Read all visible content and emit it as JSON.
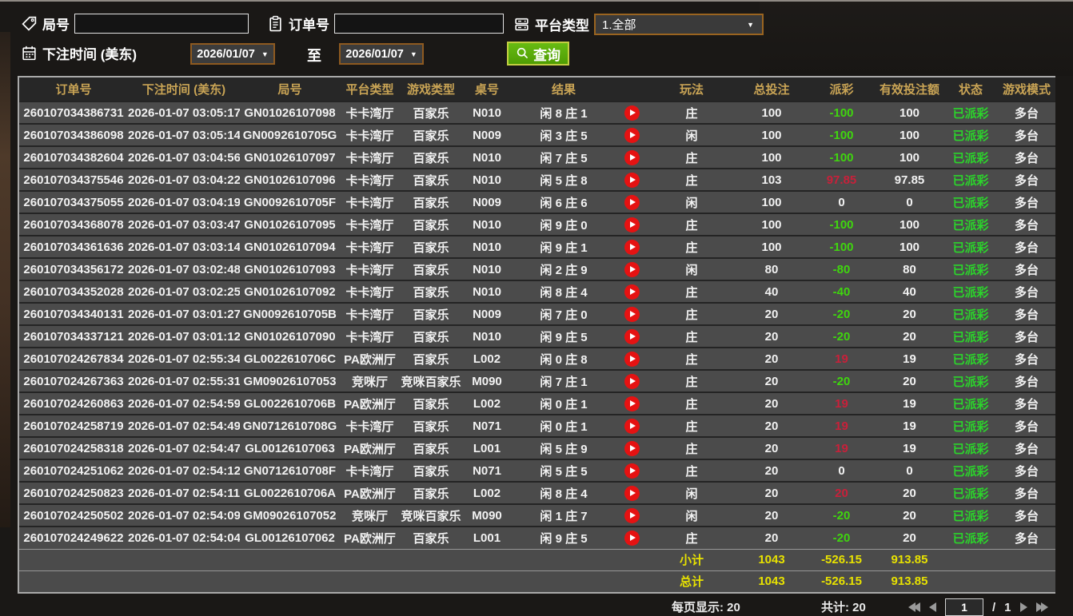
{
  "filters": {
    "game_no": {
      "label": "局号",
      "value": ""
    },
    "order_no": {
      "label": "订单号",
      "value": ""
    },
    "platform_type": {
      "label": "平台类型",
      "value": "1.全部"
    },
    "bet_time": {
      "label": "下注时间 (美东)"
    },
    "date_from": "2026/01/07",
    "to_label": "至",
    "date_to": "2026/01/07",
    "query_label": "查询"
  },
  "table": {
    "headers": [
      "订单号",
      "下注时间 (美东)",
      "局号",
      "平台类型",
      "游戏类型",
      "桌号",
      "结果",
      "",
      "玩法",
      "总投注",
      "派彩",
      "有效投注额",
      "状态",
      "游戏模式"
    ],
    "rows": [
      {
        "order_no": "260107034386731",
        "bet_time": "2026-01-07 03:05:17",
        "game_no": "GN01026107098",
        "platform": "卡卡湾厅",
        "game_type": "百家乐",
        "table_no": "N010",
        "result": "闲 8 庄 1",
        "play": "庄",
        "total_bet": "100",
        "payout": "-100",
        "payout_color": "green",
        "valid_bet": "100",
        "status": "已派彩",
        "mode": "多台"
      },
      {
        "order_no": "260107034386098",
        "bet_time": "2026-01-07 03:05:14",
        "game_no": "GN0092610705G",
        "platform": "卡卡湾厅",
        "game_type": "百家乐",
        "table_no": "N009",
        "result": "闲 3 庄 5",
        "play": "闲",
        "total_bet": "100",
        "payout": "-100",
        "payout_color": "green",
        "valid_bet": "100",
        "status": "已派彩",
        "mode": "多台"
      },
      {
        "order_no": "260107034382604",
        "bet_time": "2026-01-07 03:04:56",
        "game_no": "GN01026107097",
        "platform": "卡卡湾厅",
        "game_type": "百家乐",
        "table_no": "N010",
        "result": "闲 7 庄 5",
        "play": "庄",
        "total_bet": "100",
        "payout": "-100",
        "payout_color": "green",
        "valid_bet": "100",
        "status": "已派彩",
        "mode": "多台"
      },
      {
        "order_no": "260107034375546",
        "bet_time": "2026-01-07 03:04:22",
        "game_no": "GN01026107096",
        "platform": "卡卡湾厅",
        "game_type": "百家乐",
        "table_no": "N010",
        "result": "闲 5 庄 8",
        "play": "庄",
        "total_bet": "103",
        "payout": "97.85",
        "payout_color": "red",
        "valid_bet": "97.85",
        "status": "已派彩",
        "mode": "多台"
      },
      {
        "order_no": "260107034375055",
        "bet_time": "2026-01-07 03:04:19",
        "game_no": "GN0092610705F",
        "platform": "卡卡湾厅",
        "game_type": "百家乐",
        "table_no": "N009",
        "result": "闲 6 庄 6",
        "play": "闲",
        "total_bet": "100",
        "payout": "0",
        "payout_color": "white",
        "valid_bet": "0",
        "status": "已派彩",
        "mode": "多台"
      },
      {
        "order_no": "260107034368078",
        "bet_time": "2026-01-07 03:03:47",
        "game_no": "GN01026107095",
        "platform": "卡卡湾厅",
        "game_type": "百家乐",
        "table_no": "N010",
        "result": "闲 9 庄 0",
        "play": "庄",
        "total_bet": "100",
        "payout": "-100",
        "payout_color": "green",
        "valid_bet": "100",
        "status": "已派彩",
        "mode": "多台"
      },
      {
        "order_no": "260107034361636",
        "bet_time": "2026-01-07 03:03:14",
        "game_no": "GN01026107094",
        "platform": "卡卡湾厅",
        "game_type": "百家乐",
        "table_no": "N010",
        "result": "闲 9 庄 1",
        "play": "庄",
        "total_bet": "100",
        "payout": "-100",
        "payout_color": "green",
        "valid_bet": "100",
        "status": "已派彩",
        "mode": "多台"
      },
      {
        "order_no": "260107034356172",
        "bet_time": "2026-01-07 03:02:48",
        "game_no": "GN01026107093",
        "platform": "卡卡湾厅",
        "game_type": "百家乐",
        "table_no": "N010",
        "result": "闲 2 庄 9",
        "play": "闲",
        "total_bet": "80",
        "payout": "-80",
        "payout_color": "green",
        "valid_bet": "80",
        "status": "已派彩",
        "mode": "多台"
      },
      {
        "order_no": "260107034352028",
        "bet_time": "2026-01-07 03:02:25",
        "game_no": "GN01026107092",
        "platform": "卡卡湾厅",
        "game_type": "百家乐",
        "table_no": "N010",
        "result": "闲 8 庄 4",
        "play": "庄",
        "total_bet": "40",
        "payout": "-40",
        "payout_color": "green",
        "valid_bet": "40",
        "status": "已派彩",
        "mode": "多台"
      },
      {
        "order_no": "260107034340131",
        "bet_time": "2026-01-07 03:01:27",
        "game_no": "GN0092610705B",
        "platform": "卡卡湾厅",
        "game_type": "百家乐",
        "table_no": "N009",
        "result": "闲 7 庄 0",
        "play": "庄",
        "total_bet": "20",
        "payout": "-20",
        "payout_color": "green",
        "valid_bet": "20",
        "status": "已派彩",
        "mode": "多台"
      },
      {
        "order_no": "260107034337121",
        "bet_time": "2026-01-07 03:01:12",
        "game_no": "GN01026107090",
        "platform": "卡卡湾厅",
        "game_type": "百家乐",
        "table_no": "N010",
        "result": "闲 9 庄 5",
        "play": "庄",
        "total_bet": "20",
        "payout": "-20",
        "payout_color": "green",
        "valid_bet": "20",
        "status": "已派彩",
        "mode": "多台"
      },
      {
        "order_no": "260107024267834",
        "bet_time": "2026-01-07 02:55:34",
        "game_no": "GL0022610706C",
        "platform": "PA欧洲厅",
        "game_type": "百家乐",
        "table_no": "L002",
        "result": "闲 0 庄 8",
        "play": "庄",
        "total_bet": "20",
        "payout": "19",
        "payout_color": "red",
        "valid_bet": "19",
        "status": "已派彩",
        "mode": "多台"
      },
      {
        "order_no": "260107024267363",
        "bet_time": "2026-01-07 02:55:31",
        "game_no": "GM09026107053",
        "platform": "竞咪厅",
        "game_type": "竞咪百家乐",
        "table_no": "M090",
        "result": "闲 7 庄 1",
        "play": "庄",
        "total_bet": "20",
        "payout": "-20",
        "payout_color": "green",
        "valid_bet": "20",
        "status": "已派彩",
        "mode": "多台"
      },
      {
        "order_no": "260107024260863",
        "bet_time": "2026-01-07 02:54:59",
        "game_no": "GL0022610706B",
        "platform": "PA欧洲厅",
        "game_type": "百家乐",
        "table_no": "L002",
        "result": "闲 0 庄 1",
        "play": "庄",
        "total_bet": "20",
        "payout": "19",
        "payout_color": "red",
        "valid_bet": "19",
        "status": "已派彩",
        "mode": "多台"
      },
      {
        "order_no": "260107024258719",
        "bet_time": "2026-01-07 02:54:49",
        "game_no": "GN0712610708G",
        "platform": "卡卡湾厅",
        "game_type": "百家乐",
        "table_no": "N071",
        "result": "闲 0 庄 1",
        "play": "庄",
        "total_bet": "20",
        "payout": "19",
        "payout_color": "red",
        "valid_bet": "19",
        "status": "已派彩",
        "mode": "多台"
      },
      {
        "order_no": "260107024258318",
        "bet_time": "2026-01-07 02:54:47",
        "game_no": "GL00126107063",
        "platform": "PA欧洲厅",
        "game_type": "百家乐",
        "table_no": "L001",
        "result": "闲 5 庄 9",
        "play": "庄",
        "total_bet": "20",
        "payout": "19",
        "payout_color": "red",
        "valid_bet": "19",
        "status": "已派彩",
        "mode": "多台"
      },
      {
        "order_no": "260107024251062",
        "bet_time": "2026-01-07 02:54:12",
        "game_no": "GN0712610708F",
        "platform": "卡卡湾厅",
        "game_type": "百家乐",
        "table_no": "N071",
        "result": "闲 5 庄 5",
        "play": "庄",
        "total_bet": "20",
        "payout": "0",
        "payout_color": "white",
        "valid_bet": "0",
        "status": "已派彩",
        "mode": "多台"
      },
      {
        "order_no": "260107024250823",
        "bet_time": "2026-01-07 02:54:11",
        "game_no": "GL0022610706A",
        "platform": "PA欧洲厅",
        "game_type": "百家乐",
        "table_no": "L002",
        "result": "闲 8 庄 4",
        "play": "闲",
        "total_bet": "20",
        "payout": "20",
        "payout_color": "red",
        "valid_bet": "20",
        "status": "已派彩",
        "mode": "多台"
      },
      {
        "order_no": "260107024250502",
        "bet_time": "2026-01-07 02:54:09",
        "game_no": "GM09026107052",
        "platform": "竞咪厅",
        "game_type": "竞咪百家乐",
        "table_no": "M090",
        "result": "闲 1 庄 7",
        "play": "闲",
        "total_bet": "20",
        "payout": "-20",
        "payout_color": "green",
        "valid_bet": "20",
        "status": "已派彩",
        "mode": "多台"
      },
      {
        "order_no": "260107024249622",
        "bet_time": "2026-01-07 02:54:04",
        "game_no": "GL00126107062",
        "platform": "PA欧洲厅",
        "game_type": "百家乐",
        "table_no": "L001",
        "result": "闲 9 庄 5",
        "play": "庄",
        "total_bet": "20",
        "payout": "-20",
        "payout_color": "green",
        "valid_bet": "20",
        "status": "已派彩",
        "mode": "多台"
      }
    ],
    "subtotal": {
      "label": "小计",
      "total_bet": "1043",
      "payout": "-526.15",
      "valid_bet": "913.85"
    },
    "total": {
      "label": "总计",
      "total_bet": "1043",
      "payout": "-526.15",
      "valid_bet": "913.85"
    }
  },
  "footer": {
    "per_page_label": "每页显示:",
    "per_page_value": "20",
    "total_label": "共计:",
    "total_value": "20",
    "page": "1",
    "page_separator": "/",
    "page_total": "1"
  },
  "colors": {
    "header_gold": "#c9a455",
    "totals_yellow": "#e8e200",
    "payout_win_red": "#c8203a",
    "payout_loss_green": "#3fd60e",
    "status_green": "#2bd52b",
    "query_button_green": "#57a90b",
    "picker_border_brown": "#8e5a20"
  }
}
